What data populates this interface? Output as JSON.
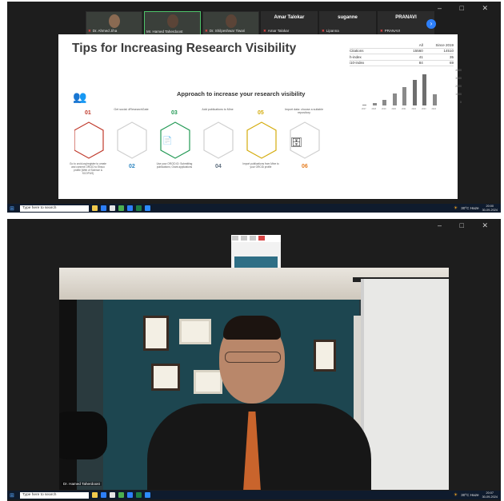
{
  "screenshot1": {
    "window_controls": [
      "–",
      "□",
      "✕"
    ],
    "participants": [
      {
        "name": "Dr. Ahmed Jiha",
        "muted": true,
        "type": "cam"
      },
      {
        "name": "Mr. Hamed Taherdoost",
        "muted": false,
        "type": "cam",
        "active": true
      },
      {
        "name": "Dr. Shilpeshwar Tiwari",
        "muted": true,
        "type": "cam"
      },
      {
        "name": "Amar Talokar",
        "big": "Amar Talokar",
        "muted": true,
        "type": "name"
      },
      {
        "name": "Lipanna",
        "big": "suganne",
        "muted": true,
        "type": "name"
      },
      {
        "name": "PRANAVI",
        "big": "PRANAVI",
        "muted": true,
        "type": "name"
      }
    ],
    "more_button": "›",
    "slide": {
      "title": "Tips for Increasing Research Visibility",
      "subtitle": "Approach to increase your research visibility",
      "citations_table": {
        "headers": [
          "",
          "All",
          "Since 2019"
        ],
        "rows": [
          [
            "Citations",
            "15560",
            "14510"
          ],
          [
            "h-index",
            "41",
            "35"
          ],
          [
            "i10-index",
            "84",
            "69"
          ]
        ]
      },
      "chart_data": {
        "type": "bar",
        "categories": [
          "2017",
          "2018",
          "2019",
          "2020",
          "2021",
          "2022",
          "2023",
          "2024"
        ],
        "values": [
          150,
          300,
          700,
          1500,
          2300,
          3200,
          3900,
          1400
        ],
        "yticks": [
          "4000",
          "3000",
          "2000",
          "1000",
          "0"
        ],
        "ylim": [
          0,
          4000
        ]
      },
      "steps": [
        {
          "num": "01",
          "color": "#c0392b",
          "top_label": "",
          "bottom_label": "Go to orcid.org/register to create and connect ORCID to Ebsco profile (Web of Science & SCOPUS)"
        },
        {
          "num": "02",
          "color": "#2e86c1",
          "top_label": "Get social: #ResearchGate",
          "bottom_label": ""
        },
        {
          "num": "03",
          "color": "#229954",
          "top_label": "",
          "bottom_label": "Use your ORCID iD: Submitting publications; Grant applications"
        },
        {
          "num": "04",
          "color": "#5d6d7e",
          "top_label": "Add publications to Mine",
          "bottom_label": ""
        },
        {
          "num": "05",
          "color": "#d4ac0d",
          "top_label": "",
          "bottom_label": "Import publications from Mine to your ORCID profile"
        },
        {
          "num": "06",
          "color": "#e67e22",
          "top_label": "Import data: choose a suitable repository",
          "bottom_label": ""
        }
      ]
    },
    "taskbar": {
      "search_placeholder": "Type here to search",
      "weather": "30°C Haze",
      "time": "20:00",
      "date": "30-09-2024"
    }
  },
  "screenshot2": {
    "window_controls": [
      "–",
      "□",
      "✕"
    ],
    "speaker_name": "Dr. Hamed Taherdoost",
    "taskbar": {
      "search_placeholder": "Type here to search",
      "weather": "30°C Haze",
      "time": "20:07",
      "date": "30-09-2024"
    }
  }
}
